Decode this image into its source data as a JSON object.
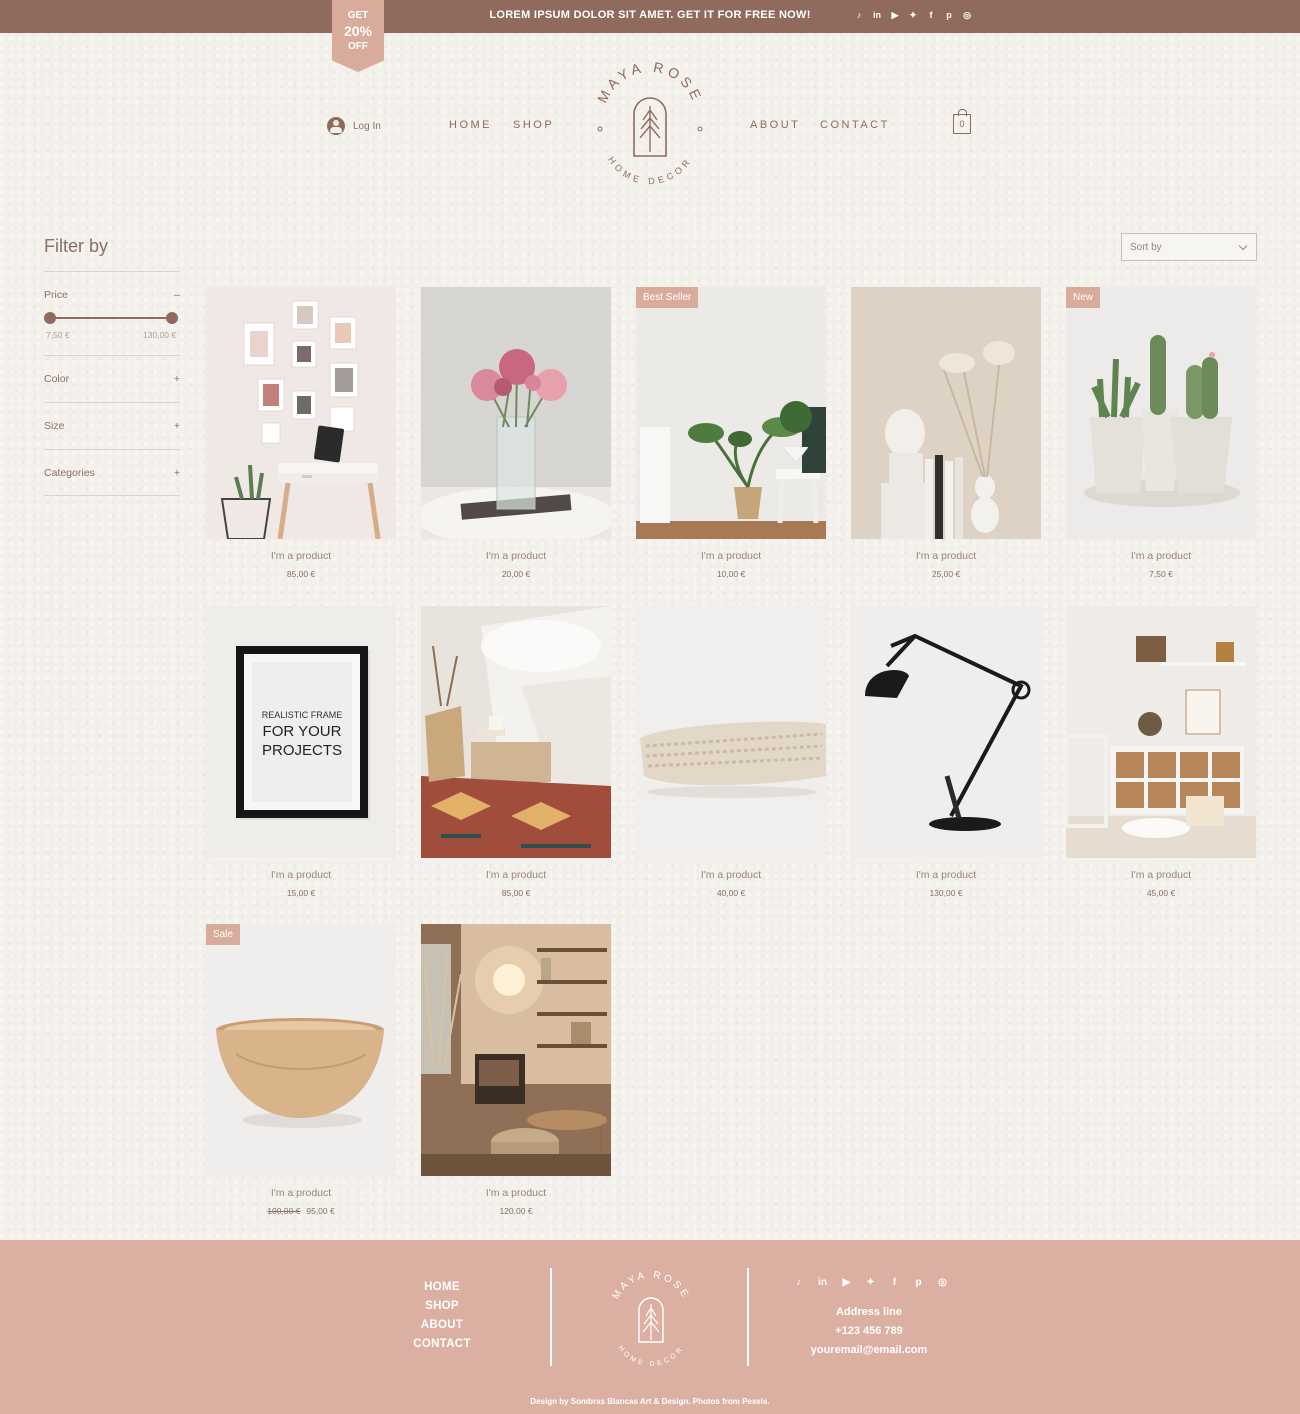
{
  "colors": {
    "brand": "#8f6a5d",
    "accent": "#d9ab9a",
    "footer": "#dbb0a3",
    "background": "#f3f0eb"
  },
  "announcement": {
    "text": "LOREM IPSUM DOLOR SIT AMET. GET IT FOR FREE NOW!",
    "promo": {
      "line1": "GET",
      "line2": "20%",
      "line3": "OFF"
    },
    "social": [
      "tiktok-icon",
      "linkedin-icon",
      "youtube-icon",
      "twitter-icon",
      "facebook-icon",
      "pinterest-icon",
      "instagram-icon"
    ]
  },
  "header": {
    "login": "Log In",
    "nav": [
      "HOME",
      "SHOP",
      "ABOUT",
      "CONTACT"
    ],
    "logo": {
      "top": "MAYA ROSE",
      "bottom": "HOME DECOR"
    },
    "cart_count": "0"
  },
  "filter": {
    "title": "Filter by",
    "price": {
      "label": "Price",
      "toggle": "–",
      "min": "7,50 €",
      "max": "130,00 €"
    },
    "sections": [
      {
        "label": "Color",
        "toggle": "+"
      },
      {
        "label": "Size",
        "toggle": "+"
      },
      {
        "label": "Categories",
        "toggle": "+"
      }
    ]
  },
  "sort": {
    "label": "Sort by"
  },
  "products": [
    {
      "name": "I'm a product",
      "price": "85,00 €",
      "badge": "",
      "image": "gallery-wall-desk"
    },
    {
      "name": "I'm a product",
      "price": "20,00 €",
      "badge": "",
      "image": "peonies-vase"
    },
    {
      "name": "I'm a product",
      "price": "10,00 €",
      "badge": "Best Seller",
      "image": "plants-stools"
    },
    {
      "name": "I'm a product",
      "price": "25,00 €",
      "badge": "",
      "image": "buddha-books"
    },
    {
      "name": "I'm a product",
      "price": "7,50 €",
      "badge": "New",
      "image": "cactus-pots"
    },
    {
      "name": "I'm a product",
      "price": "15,00 €",
      "badge": "",
      "image": "realistic-frame"
    },
    {
      "name": "I'm a product",
      "price": "85,00 €",
      "badge": "",
      "image": "bedroom-rug"
    },
    {
      "name": "I'm a product",
      "price": "40,00 €",
      "badge": "",
      "image": "knit-blanket"
    },
    {
      "name": "I'm a product",
      "price": "130,00 €",
      "badge": "",
      "image": "desk-lamp"
    },
    {
      "name": "I'm a product",
      "price": "45,00 €",
      "badge": "",
      "image": "kids-shelves"
    },
    {
      "name": "I'm a product",
      "price": "95,00 €",
      "old_price": "100,00 €",
      "badge": "Sale",
      "image": "wooden-bowl"
    },
    {
      "name": "I'm a product",
      "price": "120,00 €",
      "badge": "",
      "image": "cozy-corner"
    }
  ],
  "frame_text": {
    "line1": "REALISTIC FRAME",
    "line2": "FOR YOUR",
    "line3": "PROJECTS"
  },
  "footer": {
    "nav": [
      "HOME",
      "SHOP",
      "ABOUT",
      "CONTACT"
    ],
    "address": "Address line",
    "phone": "+123 456 789",
    "email": "youremail@email.com",
    "credit": "Design by Sombras Blancas Art & Design. Photos from Pexels."
  }
}
